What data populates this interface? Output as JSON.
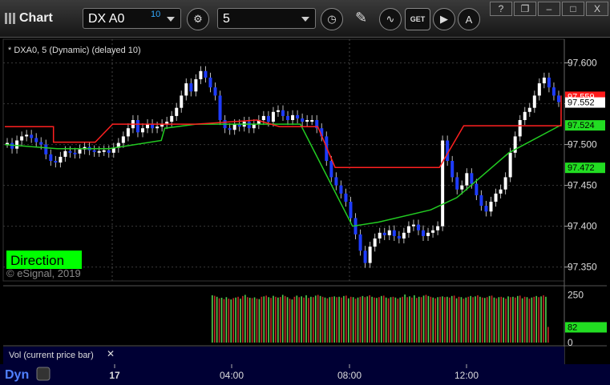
{
  "window": {
    "title": "Chart",
    "symbol": "DX A0",
    "delay_badge": "10",
    "interval": "5",
    "get_label": "GET",
    "help_label": "?",
    "close_label": "X"
  },
  "chart_data": {
    "type": "candlestick",
    "title": "* DXA0, 5 (Dynamic) (delayed 10)",
    "watermark": "© eSignal, 2019",
    "ylim": [
      97.333,
      97.629
    ],
    "yticks": [
      97.6,
      97.55,
      97.5,
      97.45,
      97.4,
      97.35
    ],
    "ytick_labels": [
      "97.600",
      "97.550",
      "97.500",
      "97.450",
      "97.400",
      "97.350"
    ],
    "xtick_labels": [
      {
        "label": "17",
        "time": "00:00"
      },
      {
        "label": "04:00",
        "time": "04:00"
      },
      {
        "label": "08:00",
        "time": "08:00"
      },
      {
        "label": "12:00",
        "time": "12:00"
      }
    ],
    "time_start": "23:00",
    "time_end": "15:30",
    "price_close": [
      97.502,
      97.495,
      97.505,
      97.51,
      97.512,
      97.508,
      97.503,
      97.5,
      97.488,
      97.48,
      97.478,
      97.485,
      97.492,
      97.49,
      97.489,
      97.494,
      97.497,
      97.493,
      97.491,
      97.492,
      97.493,
      97.49,
      97.496,
      97.502,
      97.51,
      97.52,
      97.53,
      97.515,
      97.52,
      97.525,
      97.52,
      97.522,
      97.525,
      97.528,
      97.535,
      97.545,
      97.56,
      97.575,
      97.565,
      97.58,
      97.59,
      97.582,
      97.57,
      97.56,
      97.53,
      97.52,
      97.518,
      97.525,
      97.522,
      97.528,
      97.52,
      97.525,
      97.53,
      97.535,
      97.528,
      97.54,
      97.542,
      97.535,
      97.53,
      97.536,
      97.532,
      97.528,
      97.53,
      97.53,
      97.52,
      97.51,
      97.48,
      97.46,
      97.45,
      97.44,
      97.43,
      97.41,
      97.39,
      97.37,
      97.355,
      97.375,
      97.385,
      97.392,
      97.389,
      97.395,
      97.388,
      97.385,
      97.392,
      97.4,
      97.402,
      97.395,
      97.388,
      97.392,
      97.395,
      97.4,
      97.505,
      97.48,
      97.46,
      97.445,
      97.45,
      97.465,
      97.452,
      97.438,
      97.425,
      97.418,
      97.43,
      97.44,
      97.445,
      97.46,
      97.49,
      97.51,
      97.53,
      97.54,
      97.545,
      97.56,
      97.575,
      97.582,
      97.57,
      97.56,
      97.552
    ],
    "series": [
      {
        "name": "Price",
        "color_up": "#ffffff",
        "color_down": "#1e3cff",
        "last_value": 97.552,
        "last_label": "97.552"
      },
      {
        "name": "Red line",
        "color": "#ff2020",
        "values": [
          [
            0,
            97.522
          ],
          [
            28,
            97.522
          ],
          [
            28,
            97.503
          ],
          [
            52,
            97.503
          ],
          [
            62,
            97.525
          ],
          [
            110,
            97.525
          ],
          [
            145,
            97.53
          ],
          [
            158,
            97.522
          ],
          [
            180,
            97.522
          ],
          [
            190,
            97.472
          ],
          [
            250,
            97.472
          ],
          [
            264,
            97.523
          ],
          [
            320,
            97.523
          ],
          [
            320,
            97.56
          ]
        ],
        "last_label": "97.559",
        "note": "stepped stop line"
      },
      {
        "name": "Green line",
        "color": "#22cc22",
        "values": [
          [
            0,
            97.5
          ],
          [
            30,
            97.495
          ],
          [
            60,
            97.495
          ],
          [
            90,
            97.505
          ],
          [
            92,
            97.52
          ],
          [
            110,
            97.525
          ],
          [
            170,
            97.525
          ],
          [
            200,
            97.4
          ],
          [
            215,
            97.405
          ],
          [
            245,
            97.42
          ],
          [
            260,
            97.435
          ],
          [
            290,
            97.49
          ],
          [
            320,
            97.524
          ]
        ],
        "last_label": "97.524",
        "second_label": "97.472"
      }
    ],
    "volume": {
      "label": "Vol (current price bar)",
      "yticks": [
        250,
        0
      ],
      "ytick_labels": [
        "250",
        "0"
      ],
      "last_value": 82,
      "last_label": "82",
      "start_index": 116,
      "bars": [
        [
          1,
          248
        ],
        [
          0,
          245
        ],
        [
          1,
          240
        ],
        [
          0,
          232
        ],
        [
          1,
          235
        ],
        [
          0,
          228
        ],
        [
          1,
          238
        ],
        [
          0,
          230
        ],
        [
          1,
          226
        ],
        [
          0,
          233
        ],
        [
          1,
          236
        ],
        [
          0,
          240
        ],
        [
          1,
          230
        ],
        [
          0,
          244
        ],
        [
          1,
          250
        ],
        [
          0,
          238
        ],
        [
          1,
          235
        ],
        [
          0,
          233
        ],
        [
          1,
          237
        ],
        [
          0,
          230
        ],
        [
          1,
          228
        ],
        [
          0,
          240
        ],
        [
          1,
          242
        ],
        [
          0,
          246
        ],
        [
          1,
          238
        ],
        [
          0,
          234
        ],
        [
          1,
          245
        ],
        [
          0,
          240
        ],
        [
          1,
          236
        ],
        [
          0,
          239
        ],
        [
          1,
          250
        ],
        [
          0,
          244
        ],
        [
          1,
          238
        ],
        [
          0,
          230
        ],
        [
          1,
          226
        ],
        [
          0,
          240
        ],
        [
          1,
          246
        ],
        [
          0,
          238
        ],
        [
          1,
          242
        ],
        [
          0,
          236
        ],
        [
          1,
          248
        ],
        [
          0,
          234
        ],
        [
          1,
          240
        ],
        [
          0,
          238
        ],
        [
          1,
          246
        ],
        [
          0,
          250
        ],
        [
          1,
          244
        ],
        [
          0,
          240
        ],
        [
          1,
          236
        ],
        [
          0,
          232
        ],
        [
          1,
          238
        ],
        [
          0,
          240
        ],
        [
          1,
          242
        ],
        [
          0,
          238
        ],
        [
          1,
          240
        ],
        [
          0,
          236
        ],
        [
          1,
          244
        ],
        [
          0,
          246
        ],
        [
          1,
          232
        ],
        [
          0,
          240
        ],
        [
          1,
          238
        ],
        [
          0,
          230
        ],
        [
          1,
          236
        ],
        [
          0,
          240
        ],
        [
          1,
          244
        ],
        [
          0,
          238
        ],
        [
          1,
          242
        ],
        [
          0,
          248
        ],
        [
          1,
          240
        ],
        [
          0,
          236
        ],
        [
          1,
          234
        ],
        [
          0,
          238
        ],
        [
          1,
          244
        ],
        [
          0,
          246
        ],
        [
          1,
          236
        ],
        [
          0,
          232
        ],
        [
          1,
          238
        ],
        [
          0,
          240
        ],
        [
          1,
          236
        ],
        [
          0,
          230
        ],
        [
          1,
          236
        ],
        [
          0,
          240
        ],
        [
          1,
          252
        ],
        [
          0,
          238
        ],
        [
          1,
          242
        ],
        [
          0,
          236
        ],
        [
          1,
          248
        ],
        [
          0,
          234
        ],
        [
          1,
          240
        ],
        [
          0,
          238
        ],
        [
          1,
          246
        ],
        [
          0,
          250
        ],
        [
          1,
          244
        ],
        [
          0,
          240
        ],
        [
          1,
          236
        ],
        [
          0,
          232
        ],
        [
          1,
          238
        ],
        [
          0,
          240
        ],
        [
          1,
          242
        ],
        [
          0,
          238
        ],
        [
          1,
          240
        ],
        [
          0,
          236
        ],
        [
          1,
          244
        ],
        [
          0,
          246
        ],
        [
          1,
          232
        ],
        [
          0,
          240
        ],
        [
          1,
          238
        ],
        [
          0,
          230
        ],
        [
          1,
          236
        ],
        [
          0,
          240
        ],
        [
          1,
          244
        ],
        [
          0,
          238
        ],
        [
          1,
          242
        ],
        [
          0,
          248
        ],
        [
          1,
          240
        ],
        [
          0,
          236
        ],
        [
          1,
          234
        ],
        [
          0,
          238
        ],
        [
          1,
          244
        ],
        [
          0,
          246
        ],
        [
          1,
          236
        ],
        [
          0,
          232
        ],
        [
          1,
          238
        ],
        [
          0,
          240
        ],
        [
          1,
          236
        ],
        [
          0,
          230
        ],
        [
          1,
          242
        ],
        [
          0,
          238
        ],
        [
          1,
          240
        ],
        [
          0,
          236
        ],
        [
          1,
          244
        ],
        [
          0,
          246
        ],
        [
          1,
          232
        ],
        [
          0,
          240
        ],
        [
          1,
          238
        ],
        [
          0,
          230
        ],
        [
          1,
          236
        ],
        [
          0,
          240
        ],
        [
          1,
          244
        ],
        [
          0,
          238
        ],
        [
          1,
          242
        ],
        [
          0,
          248
        ],
        [
          1,
          240
        ],
        [
          0,
          82
        ]
      ]
    },
    "badges": {
      "direction": "Direction",
      "dyn": "Dyn"
    }
  }
}
